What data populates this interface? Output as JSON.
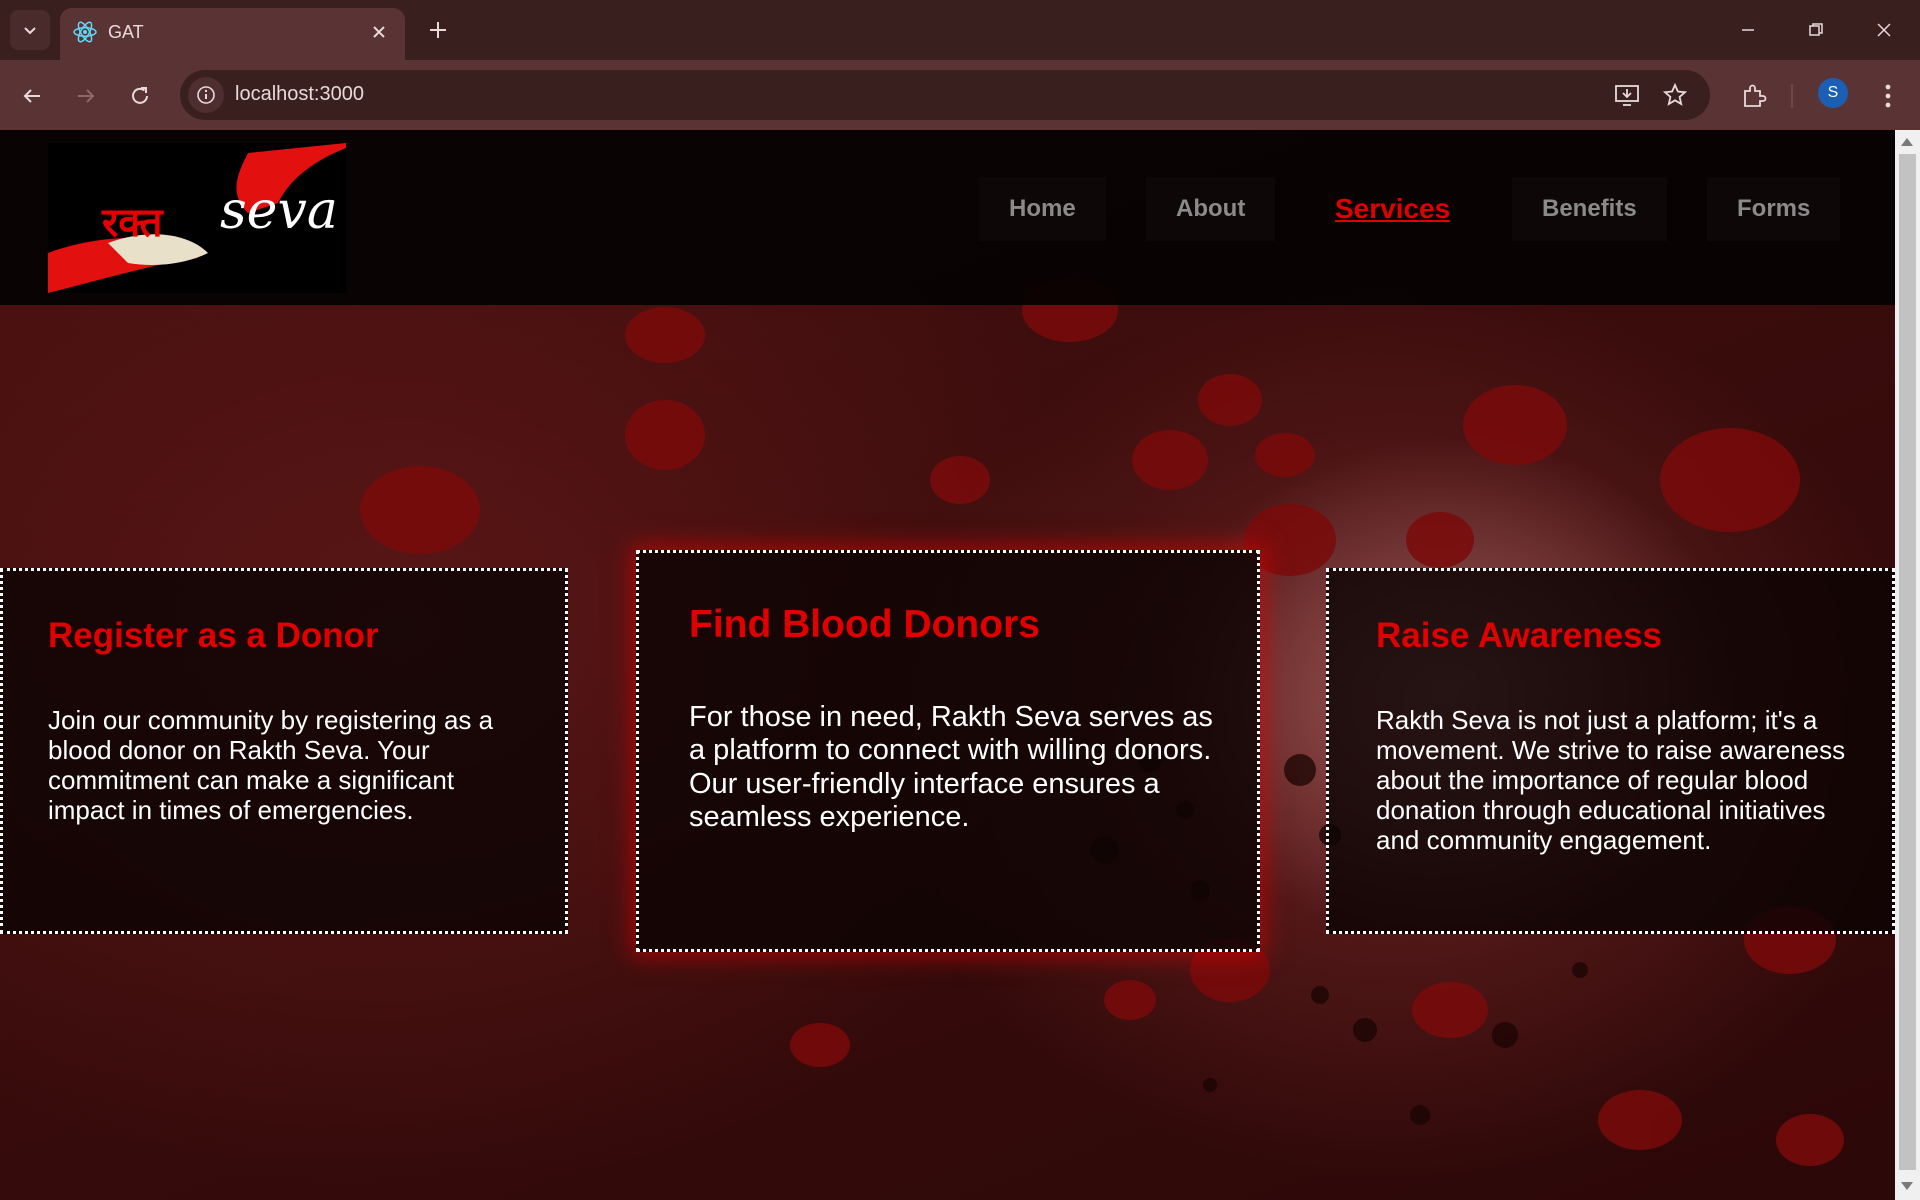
{
  "browser": {
    "tab_title": "GAT",
    "url": "localhost:3000",
    "profile_initial": "S"
  },
  "site": {
    "logo_hindi": "रक्त",
    "logo_text": "seva",
    "nav": [
      {
        "label": "Home",
        "active": false
      },
      {
        "label": "About",
        "active": false
      },
      {
        "label": "Services",
        "active": true
      },
      {
        "label": "Benefits",
        "active": false
      },
      {
        "label": "Forms",
        "active": false
      }
    ]
  },
  "cards": [
    {
      "title": "Register as a Donor",
      "body": "Join our community by registering as a blood donor on Rakth Seva. Your commitment can make a significant impact in times of emergencies."
    },
    {
      "title": "Find Blood Donors",
      "body": "For those in need, Rakth Seva serves as a platform to connect with willing donors. Our user-friendly interface ensures a seamless experience."
    },
    {
      "title": "Raise Awareness",
      "body": "Rakth Seva is not just a platform; it's a movement. We strive to raise awareness about the importance of regular blood donation through educational initiatives and community engagement."
    }
  ],
  "colors": {
    "accent": "#e00000",
    "chrome": "#5a3434",
    "card_border": "#ffffff"
  }
}
